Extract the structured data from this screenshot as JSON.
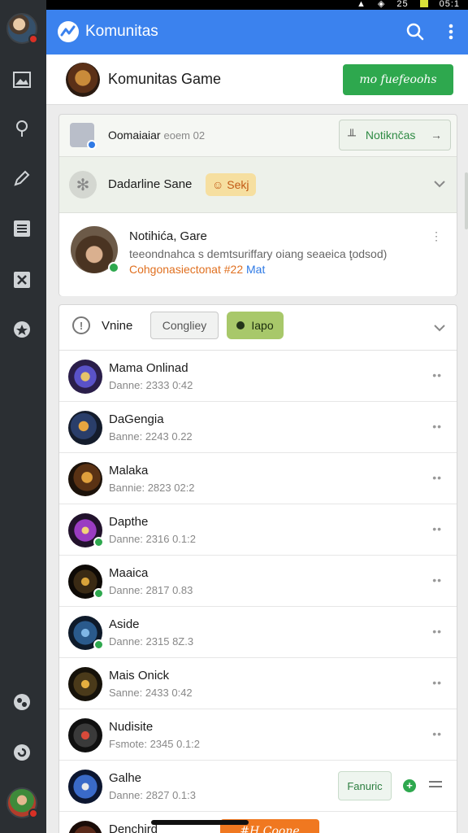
{
  "status": {
    "time": "25",
    "clock": "05:1"
  },
  "app": {
    "title": "Komunitas",
    "accent": "#3b82ee"
  },
  "community": {
    "name": "Komunitas Game",
    "follow_label": "mo fuefeoohs"
  },
  "card1": {
    "row1": {
      "label": "Oomaiaiar",
      "sub": "eoem 02",
      "notif_label": "Notiknčas"
    },
    "row2": {
      "label": "Dadarline Sane",
      "tag": "Sekj"
    },
    "post": {
      "title": "Notihića, Gare",
      "desc": "teeondnahca s demtsuriffary oiang seaeica ţodsod)",
      "link_a": "Cohgonasiectonat #22",
      "link_b": "Mat"
    }
  },
  "card2": {
    "label": "Vnine",
    "pill1": "Congliey",
    "pill2": "Iapo",
    "rows": [
      {
        "name": "Mama Onlinad",
        "meta": "Danne: 2333  0:42"
      },
      {
        "name": "DaGengia",
        "meta": "Banne: 2243  0.22"
      },
      {
        "name": "Malaka",
        "meta": "Bannie: 2823  02:2"
      },
      {
        "name": "Dapthe",
        "meta": "Danne: 2316  0.1:2"
      },
      {
        "name": "Maaica",
        "meta": "Danne: 2817  0.83"
      },
      {
        "name": "Aside",
        "meta": "Danne: 2315  8Z.3"
      },
      {
        "name": "Mais Onick",
        "meta": "Sanne: 2433  0:42"
      },
      {
        "name": "Nudisite",
        "meta": "Fsmote: 2345  0.1:2"
      },
      {
        "name": "Galhe",
        "meta": "Danne: 2827  0.1:3",
        "fav_label": "Fanuric"
      },
      {
        "name": "Denchird",
        "orange_label": "#H Coone"
      }
    ]
  }
}
